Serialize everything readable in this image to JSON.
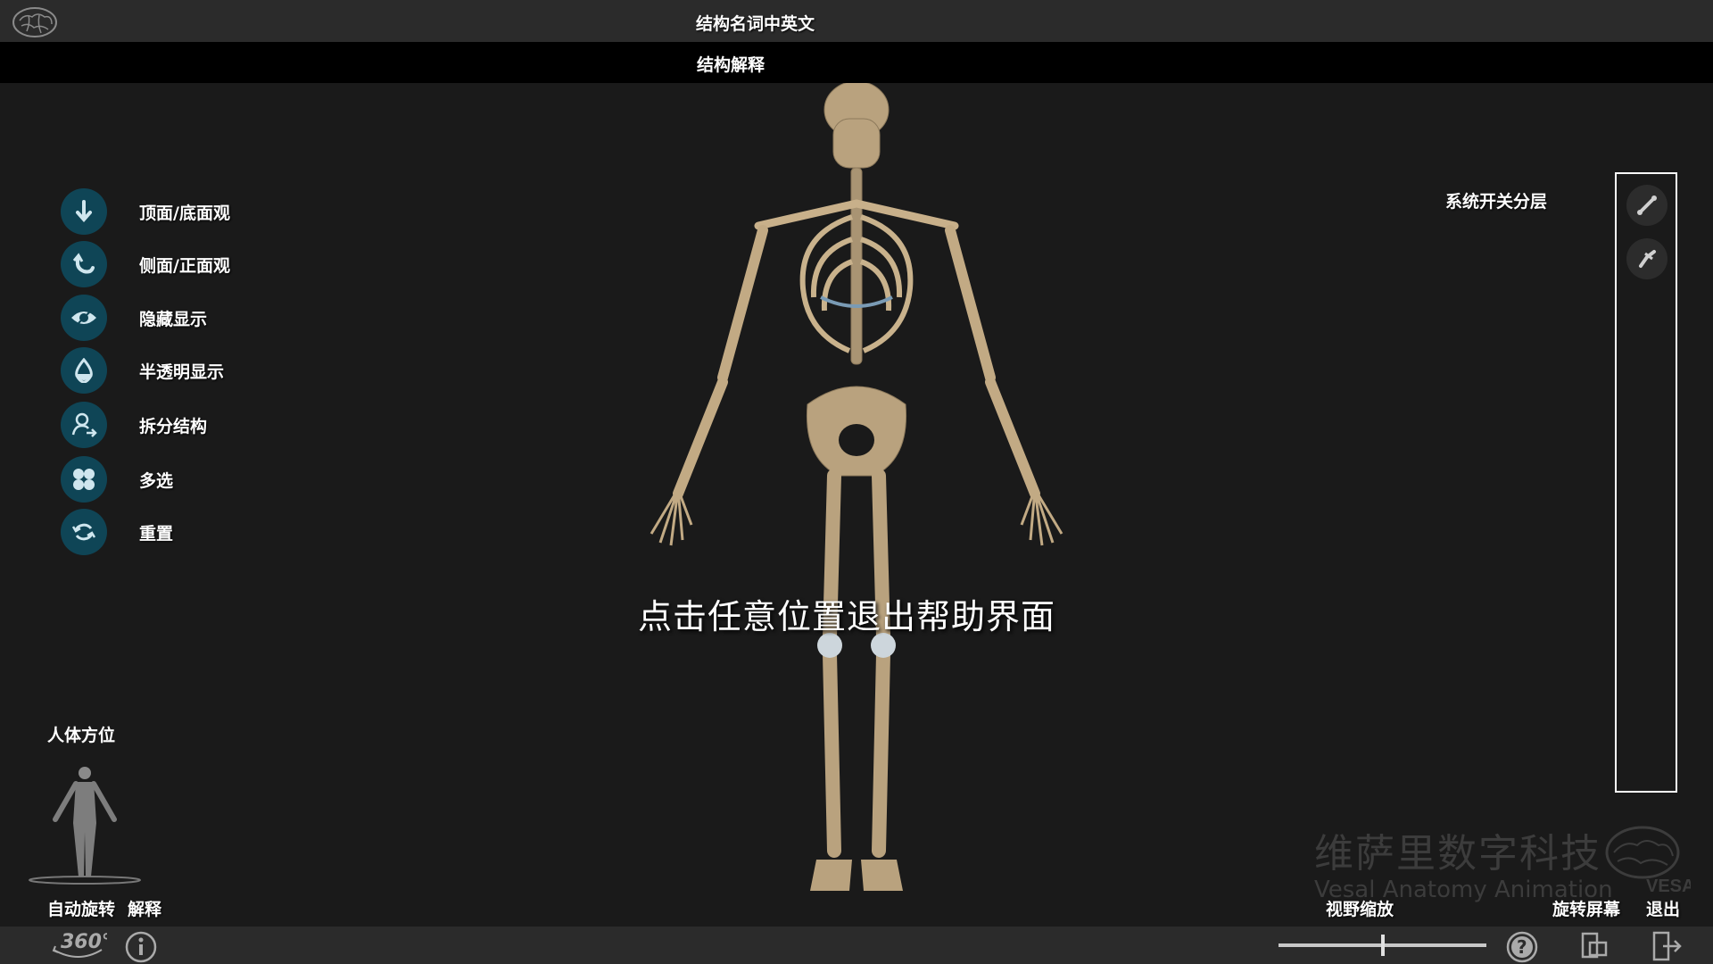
{
  "header": {
    "title": "结构名词中英文",
    "subtitle": "结构解释"
  },
  "tools": [
    {
      "label": "顶面/底面观",
      "icon": "arrow-down-icon"
    },
    {
      "label": "侧面/正面观",
      "icon": "rotate-left-icon"
    },
    {
      "label": "隐藏显示",
      "icon": "eye-icon"
    },
    {
      "label": "半透明显示",
      "icon": "droplet-icon"
    },
    {
      "label": "拆分结构",
      "icon": "person-split-icon"
    },
    {
      "label": "多选",
      "icon": "multi-select-icon"
    },
    {
      "label": "重置",
      "icon": "reset-icon"
    }
  ],
  "help_message": "点击任意位置退出帮助界面",
  "layers": {
    "label": "系统开关分层",
    "buttons": [
      {
        "icon": "bone-icon"
      },
      {
        "icon": "joint-bone-icon"
      }
    ]
  },
  "orientation": {
    "label": "人体方位"
  },
  "watermark": {
    "cn": "维萨里数字科技",
    "en": "Vesal Anatomy Animation",
    "logo_text": "VESAL"
  },
  "bottom": {
    "auto_rotate": "自动旋转",
    "explain": "解释",
    "zoom": "视野缩放",
    "rotate_screen": "旋转屏幕",
    "exit": "退出",
    "rotate_icon_text": "360°",
    "zoom_level": 0.5
  },
  "colors": {
    "tool_icon_bg": "#0f4556",
    "background": "#1a1a1a",
    "topbar": "#2b2b2b"
  }
}
